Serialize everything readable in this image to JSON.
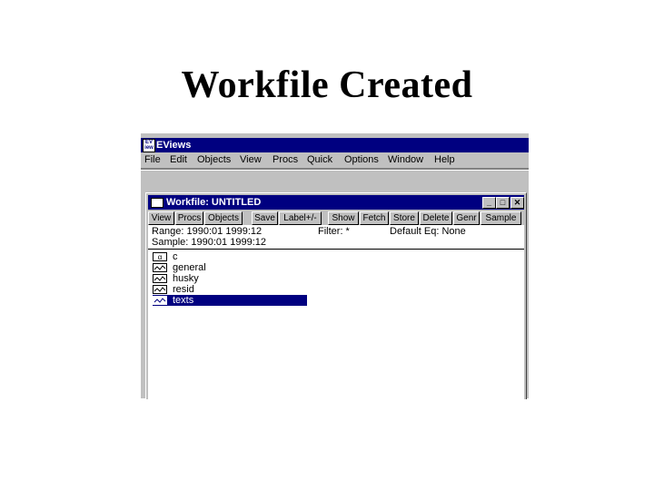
{
  "slide": {
    "title": "Workfile Created"
  },
  "app": {
    "title": "EViews",
    "menu": [
      "File",
      "Edit",
      "Objects",
      "View",
      "Procs",
      "Quick",
      "Options",
      "Window",
      "Help"
    ]
  },
  "workfile": {
    "title": "Workfile: UNTITLED",
    "controls": {
      "minimize": "_",
      "maximize": "□",
      "close": "✕"
    },
    "toolbar": [
      "View",
      "Procs",
      "Objects",
      "Save",
      "Label+/-",
      "Show",
      "Fetch",
      "Store",
      "Delete",
      "Genr",
      "Sample"
    ],
    "info": {
      "range": "Range:  1990:01 1999:12",
      "sample": "Sample: 1990:01 1999:12",
      "filter": "Filter: *",
      "default_eq": "Default Eq: None"
    },
    "objects": [
      {
        "name": "c",
        "icon": "coefficient-icon",
        "selected": false
      },
      {
        "name": "general",
        "icon": "series-icon",
        "selected": false
      },
      {
        "name": "husky",
        "icon": "series-icon",
        "selected": false
      },
      {
        "name": "resid",
        "icon": "series-icon",
        "selected": false
      },
      {
        "name": "texts",
        "icon": "series-icon",
        "selected": true
      }
    ]
  }
}
